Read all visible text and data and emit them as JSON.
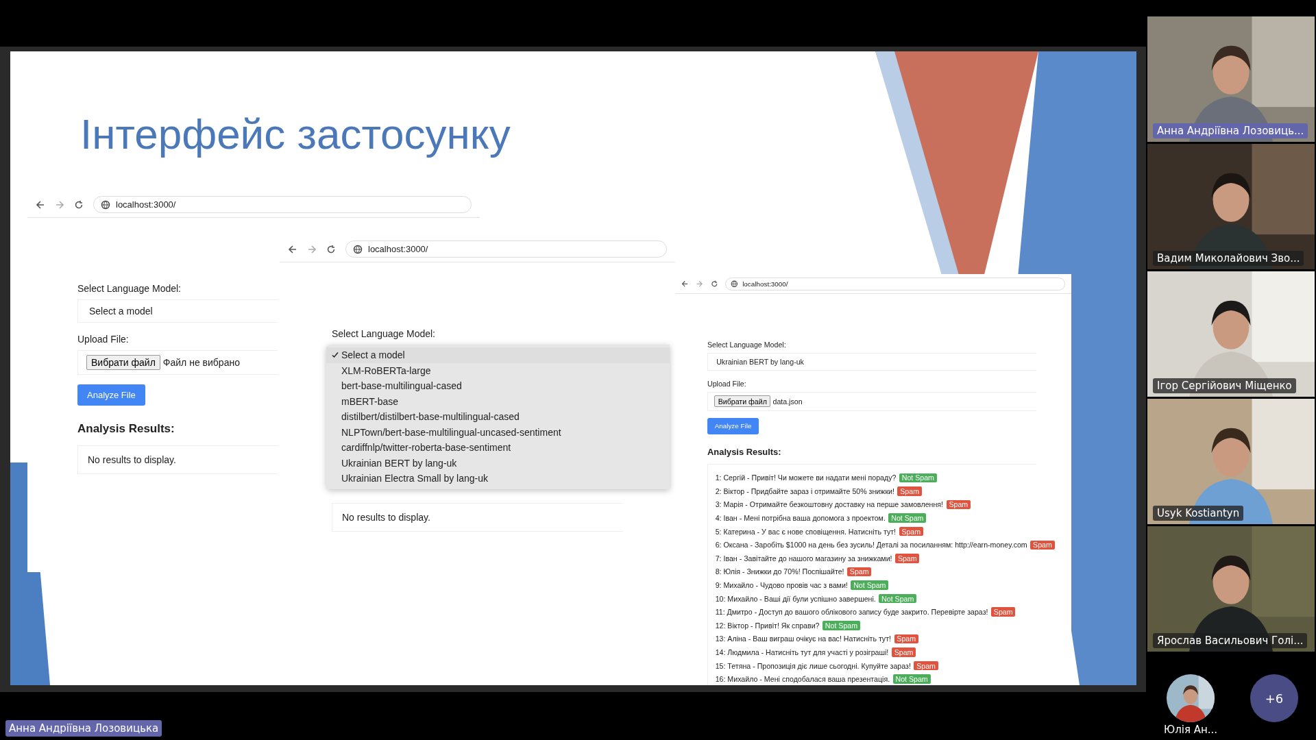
{
  "slide": {
    "title": "Інтерфейс застосунку",
    "screenshots": [
      {
        "url": "localhost:3000/",
        "model_label": "Select Language Model:",
        "model_value": "Select a model",
        "upload_label": "Upload File:",
        "file_button": "Вибрати файл",
        "file_name": "Файл не вибрано",
        "analyze_button": "Analyze File",
        "results_heading": "Analysis Results:",
        "empty_message": "No results to display."
      },
      {
        "url": "localhost:3000/",
        "model_label": "Select Language Model:",
        "dropdown": [
          {
            "label": "Select a model",
            "selected": true
          },
          {
            "label": "XLM-RoBERTa-large",
            "selected": false
          },
          {
            "label": "bert-base-multilingual-cased",
            "selected": false
          },
          {
            "label": "mBERT-base",
            "selected": false
          },
          {
            "label": "distilbert/distilbert-base-multilingual-cased",
            "selected": false
          },
          {
            "label": "NLPTown/bert-base-multilingual-uncased-sentiment",
            "selected": false
          },
          {
            "label": "cardiffnlp/twitter-roberta-base-sentiment",
            "selected": false
          },
          {
            "label": "Ukrainian BERT by lang-uk",
            "selected": false
          },
          {
            "label": "Ukrainian Electra Small by lang-uk",
            "selected": false
          }
        ],
        "empty_message": "No results to display."
      },
      {
        "url": "localhost:3000/",
        "model_label": "Select Language Model:",
        "model_value": "Ukrainian BERT by lang-uk",
        "upload_label": "Upload File:",
        "file_button": "Вибрати файл",
        "file_name": "data.json",
        "analyze_button": "Analyze File",
        "results_heading": "Analysis Results:",
        "results": [
          {
            "text": "1: Сергій - Привіт! Чи можете ви надати мені пораду?",
            "verdict": "Not Spam",
            "kind": "ham"
          },
          {
            "text": "2: Віктор - Придбайте зараз і отримайте 50% знижки!",
            "verdict": "Spam",
            "kind": "spam"
          },
          {
            "text": "3: Марія - Отримайте безкоштовну доставку на перше замовлення!",
            "verdict": "Spam",
            "kind": "spam"
          },
          {
            "text": "4: Іван - Мені потрібна ваша допомога з проектом.",
            "verdict": "Not Spam",
            "kind": "ham"
          },
          {
            "text": "5: Катерина - У вас є нове сповіщення. Натисніть тут!",
            "verdict": "Spam",
            "kind": "spam"
          },
          {
            "text": "6: Оксана - Заробіть $1000 на день без зусиль! Деталі за посиланням: http://earn-money.com",
            "verdict": "Spam",
            "kind": "spam"
          },
          {
            "text": "7: Іван - Завітайте до нашого магазину за знижками!",
            "verdict": "Spam",
            "kind": "spam"
          },
          {
            "text": "8: Юлія - Знижки до 70%! Поспішайте!",
            "verdict": "Spam",
            "kind": "spam"
          },
          {
            "text": "9: Михайло - Чудово провів час з вами!",
            "verdict": "Not Spam",
            "kind": "ham"
          },
          {
            "text": "10: Михайло - Ваші дії були успішно завершені.",
            "verdict": "Not Spam",
            "kind": "ham"
          },
          {
            "text": "11: Дмитро - Доступ до вашого облікового запису буде закрито. Перевірте зараз!",
            "verdict": "Spam",
            "kind": "spam"
          },
          {
            "text": "12: Віктор - Привіт! Як справи?",
            "verdict": "Not Spam",
            "kind": "ham"
          },
          {
            "text": "13: Аліна - Ваш виграш очікує на вас! Натисніть тут!",
            "verdict": "Spam",
            "kind": "spam"
          },
          {
            "text": "14: Людмила - Натисніть тут для участі у розіграші!",
            "verdict": "Spam",
            "kind": "spam"
          },
          {
            "text": "15: Тетяна - Пропозиція діє лише сьогодні. Купуйте зараз!",
            "verdict": "Spam",
            "kind": "spam"
          },
          {
            "text": "16: Михайло - Мені сподобалася ваша презентація.",
            "verdict": "Not Spam",
            "kind": "ham"
          }
        ]
      }
    ]
  },
  "participants": [
    {
      "name": "Анна Андріївна Лозовиць...",
      "speaking": true
    },
    {
      "name": "Вадим Миколайович Зво...",
      "speaking": false
    },
    {
      "name": "Ігор Сергійович Міщенко",
      "speaking": false
    },
    {
      "name": "Usyk Kostiantyn",
      "speaking": false
    },
    {
      "name": "Ярослав Васильович Голі...",
      "speaking": false
    }
  ],
  "overflow": {
    "avatar_name": "Юлія Ан...",
    "more_count": "+6"
  },
  "presenter": "Анна Андріївна Лозовицька"
}
